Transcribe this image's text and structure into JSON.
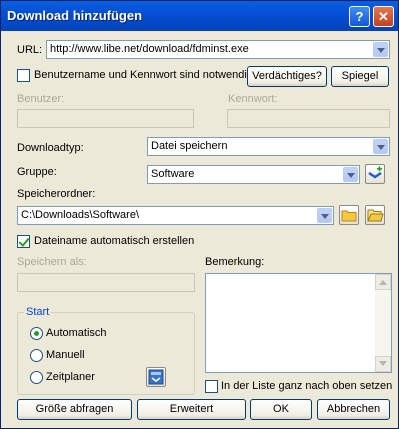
{
  "window": {
    "title": "Download hinzufügen",
    "help_label": "?",
    "close_label": "✕"
  },
  "url": {
    "label": "URL:",
    "value": "http://www.libe.net/download/fdminst.exe"
  },
  "auth": {
    "checkbox_label": "Benutzername und Kennwort sind notwendig",
    "checked": false,
    "suspicious_button": "Verdächtiges?",
    "mirror_button": "Spiegel",
    "user_label": "Benutzer:",
    "user_value": "",
    "password_label": "Kennwort:",
    "password_value": ""
  },
  "download_type": {
    "label": "Downloadtyp:",
    "value": "Datei speichern"
  },
  "group": {
    "label": "Gruppe:",
    "value": "Software"
  },
  "folder": {
    "label": "Speicherordner:",
    "value": "C:\\Downloads\\Software\\"
  },
  "auto_name": {
    "label": "Dateiname automatisch erstellen",
    "checked": true
  },
  "save_as": {
    "label": "Speichern als:",
    "value": ""
  },
  "comment": {
    "label": "Bemerkung:",
    "value": ""
  },
  "start": {
    "title": "Start",
    "options": [
      "Automatisch",
      "Manuell",
      "Zeitplaner"
    ],
    "selected": "Automatisch"
  },
  "top_of_list": {
    "label": "In der Liste ganz nach oben setzen",
    "checked": false
  },
  "buttons": {
    "query_size": "Größe abfragen",
    "advanced": "Erweitert",
    "ok": "OK",
    "cancel": "Abbrechen"
  },
  "icons": {
    "help": "help-icon",
    "close": "close-icon",
    "add_group": "add-group-icon",
    "folder_last": "folder-recent-icon",
    "folder_browse": "folder-browse-icon",
    "scheduler": "scheduler-icon"
  },
  "colors": {
    "title_bar": "#0550D6",
    "dialog_bg": "#ECE9D8",
    "group_title": "#0046D5"
  }
}
